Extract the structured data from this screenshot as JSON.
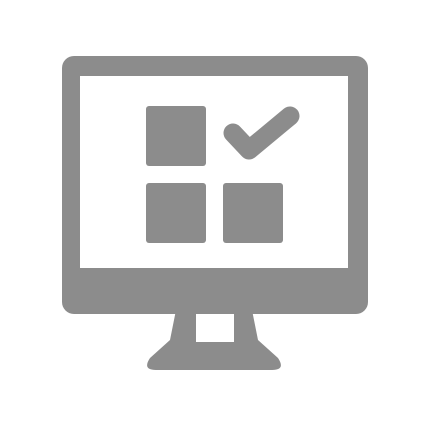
{
  "icon": {
    "name": "monitor-app-checklist-icon",
    "color": "#8c8c8c",
    "background": "#ffffff",
    "parts": [
      "monitor-frame",
      "monitor-screen",
      "monitor-stand",
      "app-tile-top-left",
      "app-tile-bottom-left",
      "app-tile-bottom-right",
      "checkmark"
    ]
  }
}
